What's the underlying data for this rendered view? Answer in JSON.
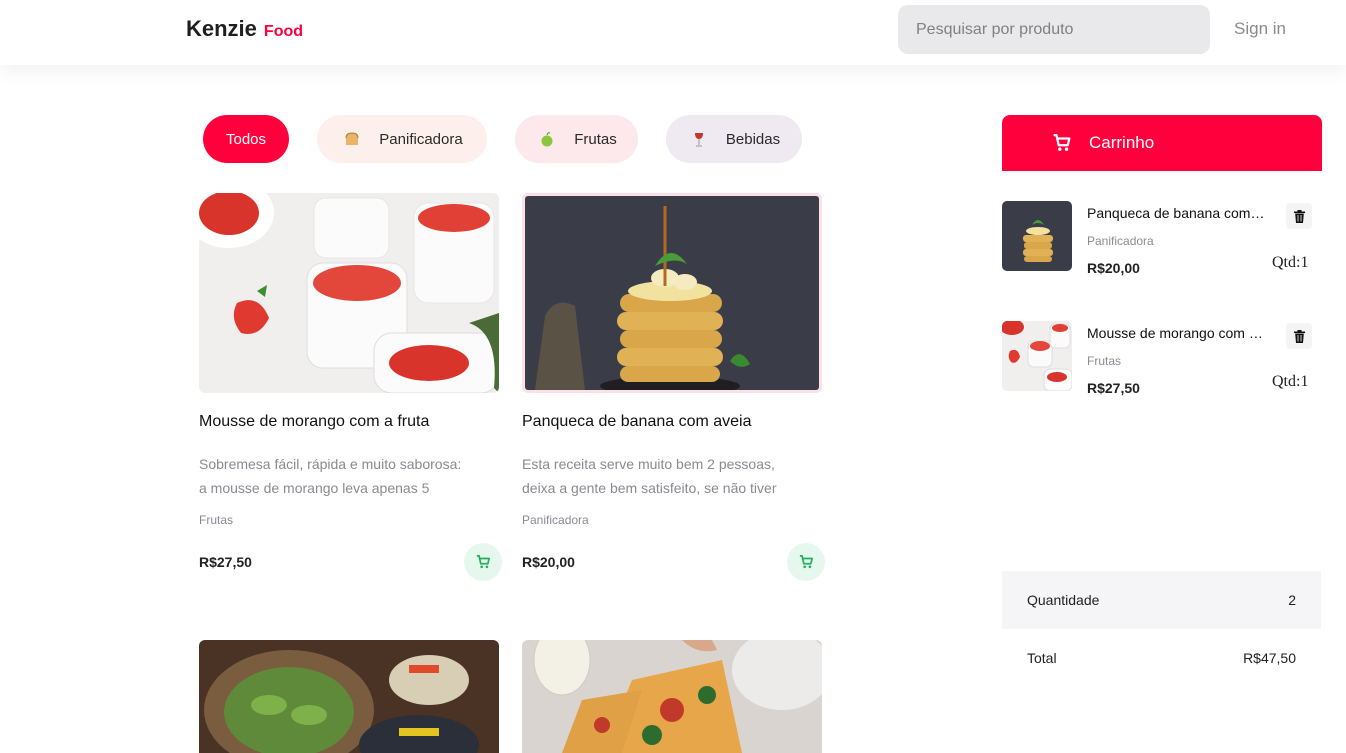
{
  "header": {
    "brand_main": "Kenzie",
    "brand_sub": "Food",
    "search_placeholder": "Pesquisar por produto",
    "signin_label": "Sign in"
  },
  "colors": {
    "accent": "#ff003d",
    "green_btn_bg": "#e6f8ee",
    "green_icon": "#27ae60"
  },
  "categories": [
    {
      "label": "Todos",
      "icon": ""
    },
    {
      "label": "Panificadora",
      "icon": "bread-icon"
    },
    {
      "label": "Frutas",
      "icon": "apple-icon"
    },
    {
      "label": "Bebidas",
      "icon": "wine-icon"
    }
  ],
  "products": [
    {
      "title": "Mousse de morango com a fruta",
      "description_line1": "Sobremesa fácil, rápida e muito saborosa:",
      "description_line2": "a mousse de morango leva apenas 5",
      "category": "Frutas",
      "price": "R$27,50"
    },
    {
      "title": "Panqueca de banana com aveia",
      "description_line1": "Esta receita serve muito bem 2 pessoas,",
      "description_line2": "deixa a gente bem satisfeito, se não tiver",
      "category": "Panificadora",
      "price": "R$20,00"
    }
  ],
  "cart": {
    "title": "Carrinho",
    "items": [
      {
        "name": "Panqueca de banana com aveia",
        "category": "Panificadora",
        "price": "R$20,00",
        "qty": "Qtd:1"
      },
      {
        "name": "Mousse de morango com a fruta",
        "category": "Frutas",
        "price": "R$27,50",
        "qty": "Qtd:1"
      }
    ],
    "quantity_label": "Quantidade",
    "quantity_value": "2",
    "total_label": "Total",
    "total_value": "R$47,50"
  }
}
